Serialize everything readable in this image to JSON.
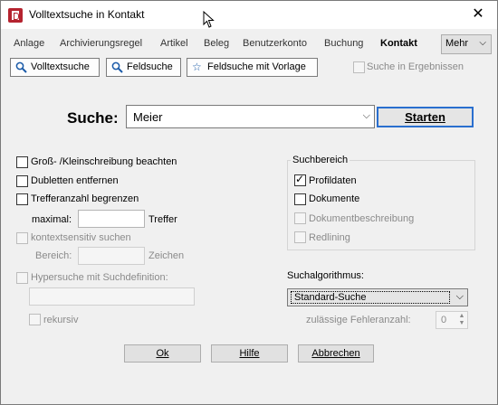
{
  "window": {
    "title": "Volltextsuche in Kontakt"
  },
  "tabs": [
    {
      "label": "Anlage"
    },
    {
      "label": "Archivierungsregel"
    },
    {
      "label": "Artikel"
    },
    {
      "label": "Beleg"
    },
    {
      "label": "Benutzerkonto"
    },
    {
      "label": "Buchung"
    },
    {
      "label": "Kontakt"
    }
  ],
  "more_button": {
    "label": "Mehr"
  },
  "toolbar": {
    "fulltext": "Volltextsuche",
    "fieldsearch": "Feldsuche",
    "template": "Feldsuche mit Vorlage",
    "in_results": "Suche in Ergebnissen"
  },
  "search": {
    "label": "Suche:",
    "value": "Meier",
    "start_label": "Starten"
  },
  "options": {
    "case": "Groß- /Kleinschreibung beachten",
    "dedupe": "Dubletten entfernen",
    "limit": "Trefferanzahl begrenzen",
    "max_label": "maximal:",
    "max_suffix": "Treffer",
    "context": "kontextsensitiv suchen",
    "range_label": "Bereich:",
    "range_suffix": "Zeichen",
    "hyper": "Hypersuche mit Suchdefinition:",
    "recursive": "rekursiv"
  },
  "scope": {
    "title": "Suchbereich",
    "profile": "Profildaten",
    "documents": "Dokumente",
    "docdesc": "Dokumentbeschreibung",
    "redlining": "Redlining"
  },
  "algorithm": {
    "label": "Suchalgorithmus:",
    "value": "Standard-Suche",
    "errors_label": "zulässige Fehleranzahl:",
    "errors_value": "0"
  },
  "buttons": {
    "ok": "Ok",
    "help": "Hilfe",
    "cancel": "Abbrechen"
  }
}
